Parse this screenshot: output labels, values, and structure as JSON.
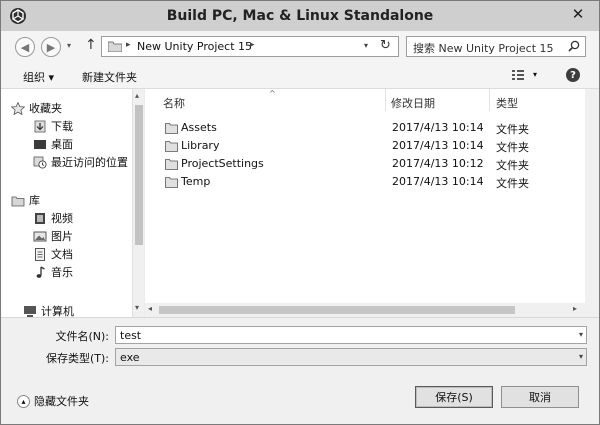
{
  "window": {
    "title": "Build PC, Mac & Linux Standalone",
    "app_icon": "unity-icon",
    "close_symbol": "✕"
  },
  "address_bar": {
    "back_symbol": "◀",
    "forward_symbol": "▶",
    "recent_symbol": "▾",
    "up_symbol": "↑",
    "breadcrumb_sep": "▸",
    "path_label": "New Unity Project 15",
    "dropdown_symbol": "▾",
    "refresh_symbol": "↻"
  },
  "search": {
    "placeholder": "搜索 New Unity Project 15",
    "icon": "search-icon"
  },
  "toolbar": {
    "organize_label": "组织 ▾",
    "new_folder_label": "新建文件夹",
    "view_dropdown_symbol": "▾",
    "help_symbol": "?"
  },
  "nav": {
    "scroll_up": "▴",
    "scroll_down": "▾",
    "items": [
      {
        "label": "收藏夹",
        "icon": "star-icon"
      },
      {
        "label": "下载",
        "icon": "download-icon"
      },
      {
        "label": "桌面",
        "icon": "desktop-icon"
      },
      {
        "label": "最近访问的位置",
        "icon": "recent-places-icon"
      },
      {
        "label": "库",
        "icon": "library-icon"
      },
      {
        "label": "视频",
        "icon": "video-icon"
      },
      {
        "label": "图片",
        "icon": "picture-icon"
      },
      {
        "label": "文档",
        "icon": "document-icon"
      },
      {
        "label": "音乐",
        "icon": "music-icon"
      },
      {
        "label": "计算机",
        "icon": "computer-icon"
      }
    ]
  },
  "file_list": {
    "columns": {
      "name": "名称",
      "date": "修改日期",
      "type": "类型"
    },
    "sort_symbol": "^",
    "rows": [
      {
        "name": "Assets",
        "date": "2017/4/13 10:14",
        "type": "文件夹"
      },
      {
        "name": "Library",
        "date": "2017/4/13 10:14",
        "type": "文件夹"
      },
      {
        "name": "ProjectSettings",
        "date": "2017/4/13 10:12",
        "type": "文件夹"
      },
      {
        "name": "Temp",
        "date": "2017/4/13 10:14",
        "type": "文件夹"
      }
    ],
    "hscroll_left": "◂",
    "hscroll_right": "▸"
  },
  "form": {
    "filename_label": "文件名(N):",
    "filename_value": "test",
    "filetype_label": "保存类型(T):",
    "filetype_value": "exe",
    "dropdown_symbol": "▾"
  },
  "footer": {
    "hide_folders_symbol": "▴",
    "hide_folders_label": "隐藏文件夹",
    "save_label": "保存(S)",
    "cancel_label": "取消"
  }
}
